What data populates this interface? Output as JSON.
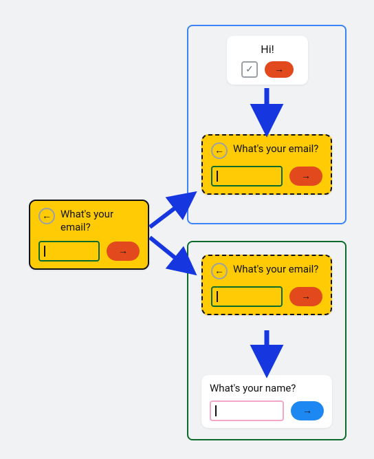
{
  "colors": {
    "canvas_bg": "#f1f2f4",
    "card_yellow": "#ffcb05",
    "card_white": "#ffffff",
    "border_solid": "#111111",
    "border_dashed": "#111111",
    "region_blue": "#3b82f6",
    "region_green": "#0b6b2b",
    "input_border_green": "#0b6b2b",
    "input_border_pink": "#f4a6c6",
    "pill_red": "#e24a1e",
    "pill_blue": "#1e88f2",
    "arrow_blue": "#1636e0",
    "back_circle_gray": "#9aa0a6"
  },
  "icons": {
    "back_arrow": "←",
    "forward_arrow": "→",
    "check": "✓"
  },
  "source_card": {
    "title": "What's your email?",
    "input_value": "",
    "back_icon": "back_arrow",
    "submit_icon": "forward_arrow"
  },
  "blue_region": {
    "hi_card": {
      "title": "Hi!",
      "checkbox_checked": true,
      "check_icon": "check",
      "submit_icon": "forward_arrow"
    },
    "email_card": {
      "title": "What's your email?",
      "input_value": "",
      "back_icon": "back_arrow",
      "submit_icon": "forward_arrow"
    }
  },
  "green_region": {
    "email_card": {
      "title": "What's your email?",
      "input_value": "",
      "back_icon": "back_arrow",
      "submit_icon": "forward_arrow"
    },
    "name_card": {
      "title": "What's your name?",
      "input_value": "",
      "submit_icon": "forward_arrow"
    }
  }
}
